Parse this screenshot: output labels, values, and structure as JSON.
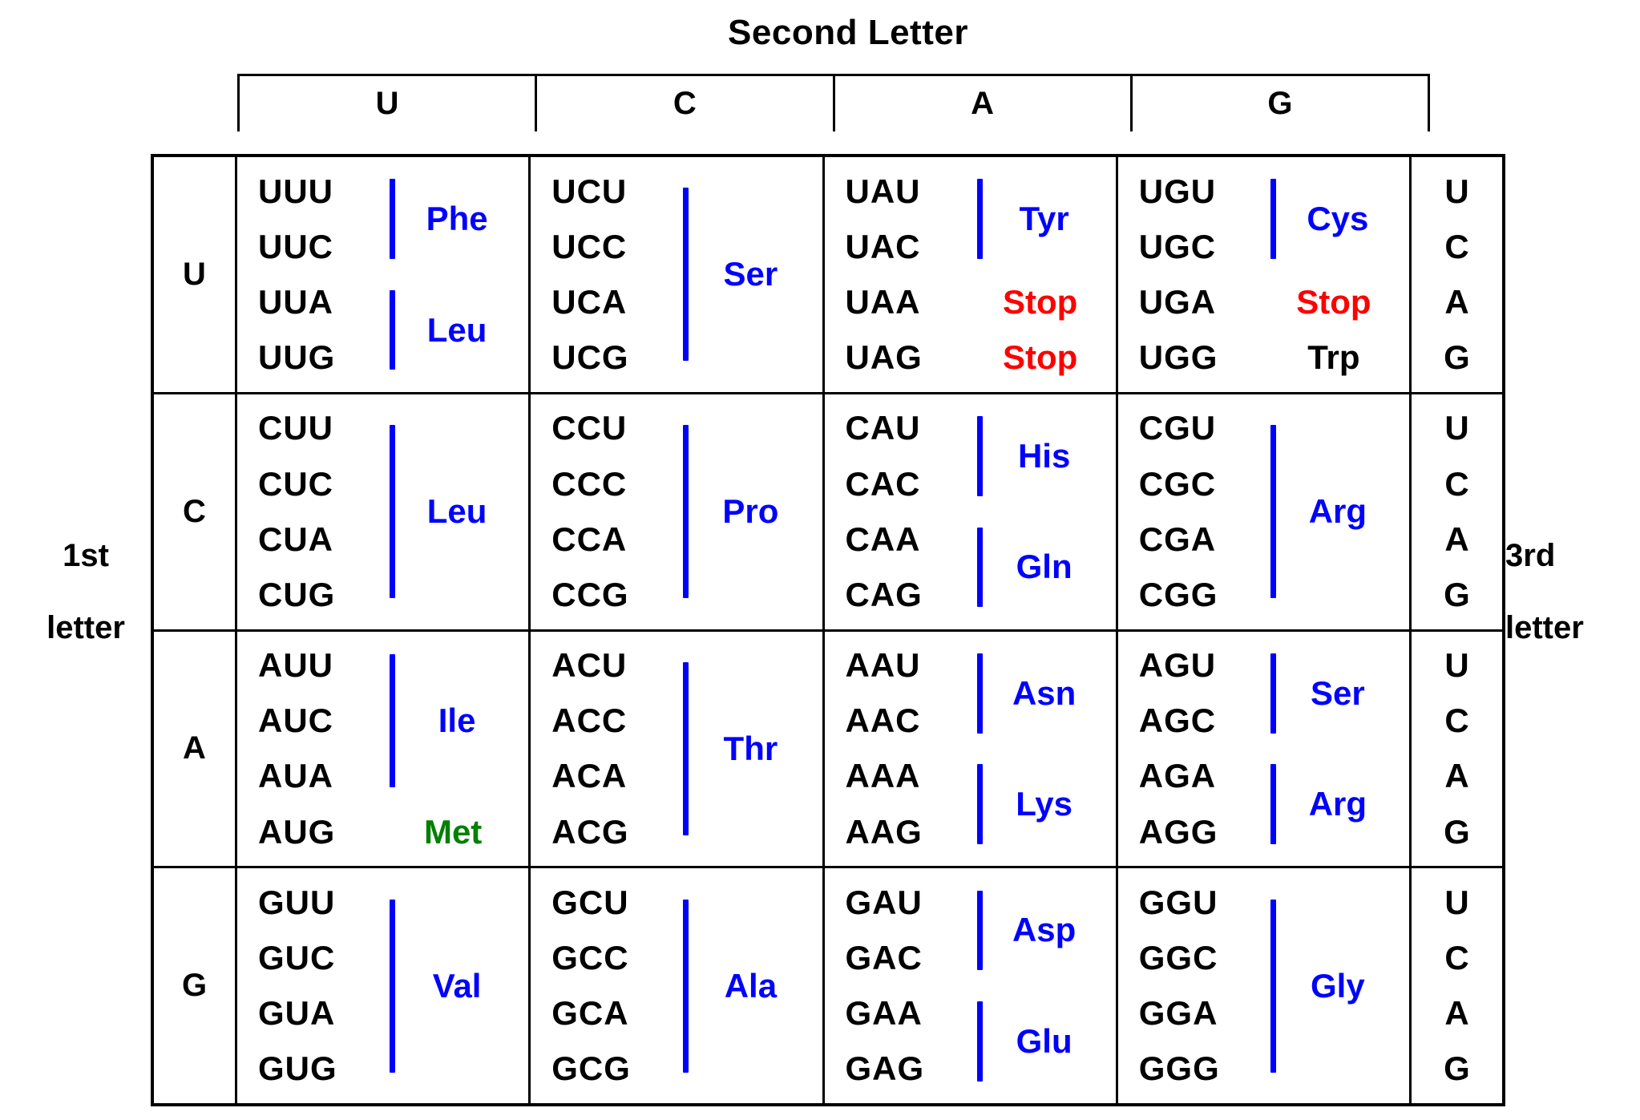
{
  "captions": {
    "second_letter": "Second Letter",
    "first_letter_line1": "1st",
    "first_letter_line2": "letter",
    "third_letter_line1": "3rd",
    "third_letter_line2": "letter"
  },
  "colors": {
    "amino_acid": "#0000FF",
    "stop": "#FF0000",
    "start_met": "#008000",
    "codon": "#000000",
    "border": "#000000",
    "background": "#FFFFFF"
  },
  "second_letter_headers": [
    "U",
    "C",
    "A",
    "G"
  ],
  "third_letter_values": [
    "U",
    "C",
    "A",
    "G"
  ],
  "rows": [
    {
      "first_letter": "U",
      "cells": [
        {
          "second_letter": "U",
          "codons": [
            "UUU",
            "UUC",
            "UUA",
            "UUG"
          ],
          "groups": [
            {
              "label": "Phe",
              "span": 2,
              "color": "blue"
            },
            {
              "label": "Leu",
              "span": 2,
              "color": "blue"
            }
          ]
        },
        {
          "second_letter": "C",
          "codons": [
            "UCU",
            "UCC",
            "UCA",
            "UCG"
          ],
          "groups": [
            {
              "label": "Ser",
              "span": 4,
              "color": "blue"
            }
          ]
        },
        {
          "second_letter": "A",
          "codons": [
            "UAU",
            "UAC",
            "UAA",
            "UAG"
          ],
          "groups": [
            {
              "label": "Tyr",
              "span": 2,
              "color": "blue"
            },
            {
              "label": "Stop",
              "span": 1,
              "color": "red"
            },
            {
              "label": "Stop",
              "span": 1,
              "color": "red"
            }
          ]
        },
        {
          "second_letter": "G",
          "codons": [
            "UGU",
            "UGC",
            "UGA",
            "UGG"
          ],
          "groups": [
            {
              "label": "Cys",
              "span": 2,
              "color": "blue"
            },
            {
              "label": "Stop",
              "span": 1,
              "color": "red"
            },
            {
              "label": "Trp",
              "span": 1,
              "color": "black"
            }
          ]
        }
      ]
    },
    {
      "first_letter": "C",
      "cells": [
        {
          "second_letter": "U",
          "codons": [
            "CUU",
            "CUC",
            "CUA",
            "CUG"
          ],
          "groups": [
            {
              "label": "Leu",
              "span": 4,
              "color": "blue"
            }
          ]
        },
        {
          "second_letter": "C",
          "codons": [
            "CCU",
            "CCC",
            "CCA",
            "CCG"
          ],
          "groups": [
            {
              "label": "Pro",
              "span": 4,
              "color": "blue"
            }
          ]
        },
        {
          "second_letter": "A",
          "codons": [
            "CAU",
            "CAC",
            "CAA",
            "CAG"
          ],
          "groups": [
            {
              "label": "His",
              "span": 2,
              "color": "blue"
            },
            {
              "label": "Gln",
              "span": 2,
              "color": "blue"
            }
          ]
        },
        {
          "second_letter": "G",
          "codons": [
            "CGU",
            "CGC",
            "CGA",
            "CGG"
          ],
          "groups": [
            {
              "label": "Arg",
              "span": 4,
              "color": "blue"
            }
          ]
        }
      ]
    },
    {
      "first_letter": "A",
      "cells": [
        {
          "second_letter": "U",
          "codons": [
            "AUU",
            "AUC",
            "AUA",
            "AUG"
          ],
          "groups": [
            {
              "label": "Ile",
              "span": 3,
              "color": "blue"
            },
            {
              "label": "Met",
              "span": 1,
              "color": "green"
            }
          ]
        },
        {
          "second_letter": "C",
          "codons": [
            "ACU",
            "ACC",
            "ACA",
            "ACG"
          ],
          "groups": [
            {
              "label": "Thr",
              "span": 4,
              "color": "blue"
            }
          ]
        },
        {
          "second_letter": "A",
          "codons": [
            "AAU",
            "AAC",
            "AAA",
            "AAG"
          ],
          "groups": [
            {
              "label": "Asn",
              "span": 2,
              "color": "blue"
            },
            {
              "label": "Lys",
              "span": 2,
              "color": "blue"
            }
          ]
        },
        {
          "second_letter": "G",
          "codons": [
            "AGU",
            "AGC",
            "AGA",
            "AGG"
          ],
          "groups": [
            {
              "label": "Ser",
              "span": 2,
              "color": "blue"
            },
            {
              "label": "Arg",
              "span": 2,
              "color": "blue"
            }
          ]
        }
      ]
    },
    {
      "first_letter": "G",
      "cells": [
        {
          "second_letter": "U",
          "codons": [
            "GUU",
            "GUC",
            "GUA",
            "GUG"
          ],
          "groups": [
            {
              "label": "Val",
              "span": 4,
              "color": "blue"
            }
          ]
        },
        {
          "second_letter": "C",
          "codons": [
            "GCU",
            "GCC",
            "GCA",
            "GCG"
          ],
          "groups": [
            {
              "label": "Ala",
              "span": 4,
              "color": "blue"
            }
          ]
        },
        {
          "second_letter": "A",
          "codons": [
            "GAU",
            "GAC",
            "GAA",
            "GAG"
          ],
          "groups": [
            {
              "label": "Asp",
              "span": 2,
              "color": "blue"
            },
            {
              "label": "Glu",
              "span": 2,
              "color": "blue"
            }
          ]
        },
        {
          "second_letter": "G",
          "codons": [
            "GGU",
            "GGC",
            "GGA",
            "GGG"
          ],
          "groups": [
            {
              "label": "Gly",
              "span": 4,
              "color": "blue"
            }
          ]
        }
      ]
    }
  ]
}
